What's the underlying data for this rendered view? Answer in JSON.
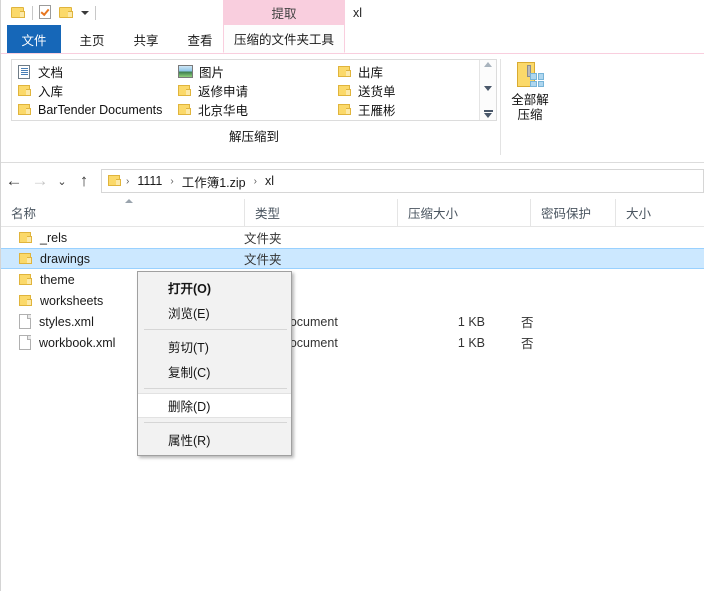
{
  "window": {
    "label": "xl"
  },
  "quick_access": {
    "items": [
      {
        "name": "folder-icon",
        "icon": "folder"
      },
      {
        "name": "properties-icon",
        "icon": "document-check"
      },
      {
        "name": "new-folder-icon",
        "icon": "folder"
      },
      {
        "name": "customize-dropdown",
        "icon": "caret-down"
      }
    ]
  },
  "ribbon": {
    "contextual_group_label": "提取",
    "tabs": [
      {
        "label": "文件",
        "id": "file",
        "active": false,
        "style": "file"
      },
      {
        "label": "主页",
        "id": "home",
        "active": false
      },
      {
        "label": "共享",
        "id": "share",
        "active": false
      },
      {
        "label": "查看",
        "id": "view",
        "active": false
      },
      {
        "label": "压缩的文件夹工具",
        "id": "compressed-folder-tools",
        "active": true
      }
    ],
    "gallery": {
      "columns": [
        [
          {
            "label": "文档",
            "icon": "documents-library-icon"
          },
          {
            "label": "入库",
            "icon": "folder-icon"
          },
          {
            "label": "BarTender Documents",
            "icon": "folder-icon"
          }
        ],
        [
          {
            "label": "图片",
            "icon": "pictures-library-icon"
          },
          {
            "label": "返修申请",
            "icon": "folder-icon"
          },
          {
            "label": "北京华电",
            "icon": "folder-icon"
          }
        ],
        [
          {
            "label": "出库",
            "icon": "folder-icon"
          },
          {
            "label": "送货单",
            "icon": "folder-icon"
          },
          {
            "label": "王雁彬",
            "icon": "folder-icon"
          }
        ]
      ]
    },
    "group_label": "解压缩到",
    "extract_all": {
      "label_line1": "全部解",
      "label_line2": "压缩"
    }
  },
  "address_bar": {
    "back_icon": "←",
    "forward_icon": "→",
    "recent_icon": "⌄",
    "up_icon": "↑",
    "breadcrumbs": [
      {
        "label": "1111"
      },
      {
        "label": "工作簿1.zip"
      },
      {
        "label": "xl"
      }
    ],
    "separator": "›"
  },
  "columns": [
    {
      "label": "名称",
      "key": "name"
    },
    {
      "label": "类型",
      "key": "type"
    },
    {
      "label": "压缩大小",
      "key": "compressed_size"
    },
    {
      "label": "密码保护",
      "key": "protected"
    },
    {
      "label": "大小",
      "key": "size"
    }
  ],
  "files": [
    {
      "name": "_rels",
      "icon": "folder-icon",
      "type": "文件夹",
      "compressed_size": "",
      "protected": "",
      "size": "",
      "selected": false
    },
    {
      "name": "drawings",
      "icon": "folder-icon",
      "type": "文件夹",
      "compressed_size": "",
      "protected": "",
      "size": "",
      "selected": true
    },
    {
      "name": "theme",
      "icon": "folder-icon",
      "type": "",
      "compressed_size": "",
      "protected": "",
      "size": "",
      "selected": false
    },
    {
      "name": "worksheets",
      "icon": "folder-icon",
      "type": "",
      "compressed_size": "",
      "protected": "",
      "size": "",
      "selected": false
    },
    {
      "name": "styles.xml",
      "icon": "xml-file-icon",
      "type": "owser Document",
      "compressed_size": "1 KB",
      "protected": "否",
      "size": "",
      "selected": false
    },
    {
      "name": "workbook.xml",
      "icon": "xml-file-icon",
      "type": "owser Document",
      "compressed_size": "1 KB",
      "protected": "否",
      "size": "",
      "selected": false
    }
  ],
  "context_menu": {
    "items": [
      {
        "label": "打开(O)",
        "bold": true,
        "hover": false
      },
      {
        "label": "浏览(E)",
        "bold": false,
        "hover": false
      },
      {
        "separator": true
      },
      {
        "label": "剪切(T)",
        "bold": false,
        "hover": false
      },
      {
        "label": "复制(C)",
        "bold": false,
        "hover": false
      },
      {
        "separator": true
      },
      {
        "label": "删除(D)",
        "bold": false,
        "hover": true
      },
      {
        "separator": true
      },
      {
        "label": "属性(R)",
        "bold": false,
        "hover": false
      }
    ]
  },
  "colors": {
    "file_tab": "#1667b8",
    "contextual_pink": "#f9cede",
    "selection": "#cce8ff",
    "folder_yellow": "#fbd96a"
  }
}
